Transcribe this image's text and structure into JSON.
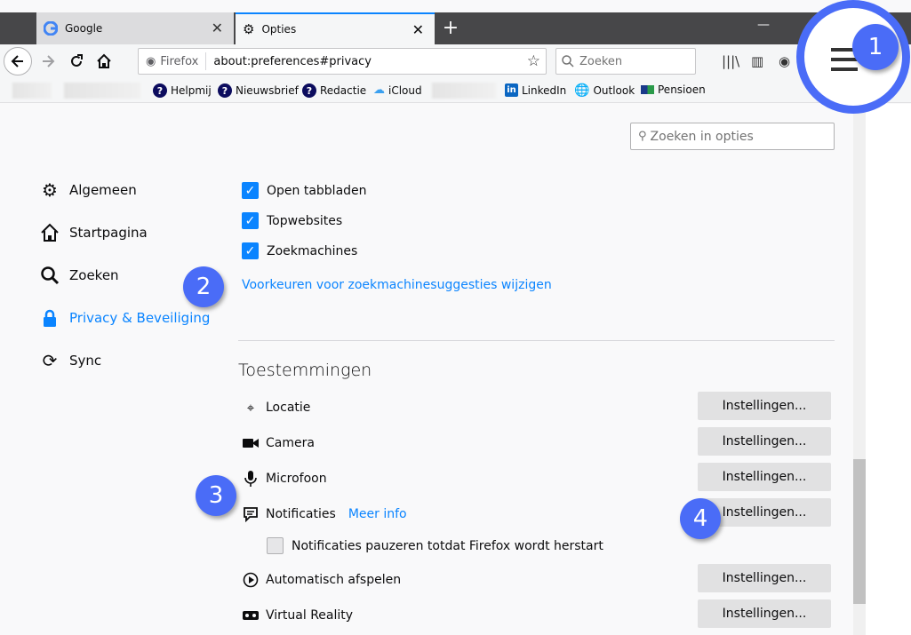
{
  "tabs": [
    {
      "label": "Google"
    },
    {
      "label": "Opties"
    }
  ],
  "urlbar": {
    "identity": "Firefox",
    "url": "about:preferences#privacy"
  },
  "searchbar": {
    "placeholder": "Zoeken"
  },
  "bookmarks": [
    {
      "label": "Helpmij"
    },
    {
      "label": "Nieuwsbrief"
    },
    {
      "label": "Redactie"
    },
    {
      "label": "iCloud"
    },
    {
      "label": "LinkedIn"
    },
    {
      "label": "Outlook"
    },
    {
      "label": "Pensioen"
    }
  ],
  "prefs_search": {
    "placeholder": "Zoeken in opties"
  },
  "categories": [
    {
      "label": "Algemeen"
    },
    {
      "label": "Startpagina"
    },
    {
      "label": "Zoeken"
    },
    {
      "label": "Privacy & Beveiliging"
    },
    {
      "label": "Sync"
    }
  ],
  "suggestions": [
    {
      "label": "Open tabbladen",
      "checked": true
    },
    {
      "label": "Topwebsites",
      "checked": true
    },
    {
      "label": "Zoekmachines",
      "checked": true
    }
  ],
  "suggestions_link": "Voorkeuren voor zoekmachinesuggesties wijzigen",
  "permissions": {
    "heading": "Toestemmingen",
    "button_label": "Instellingen...",
    "items": [
      {
        "label": "Locatie"
      },
      {
        "label": "Camera"
      },
      {
        "label": "Microfoon"
      },
      {
        "label": "Notificaties",
        "extra_link": "Meer info"
      },
      {
        "label": "Automatisch afspelen"
      },
      {
        "label": "Virtual Reality"
      }
    ],
    "pause_notifications": {
      "label": "Notificaties pauzeren totdat Firefox wordt herstart",
      "checked": false
    }
  },
  "callouts": [
    "1",
    "2",
    "3",
    "4"
  ],
  "colors": {
    "accent": "#0a84ff",
    "callout": "#4a6cf7",
    "tabstrip": "#474749"
  }
}
